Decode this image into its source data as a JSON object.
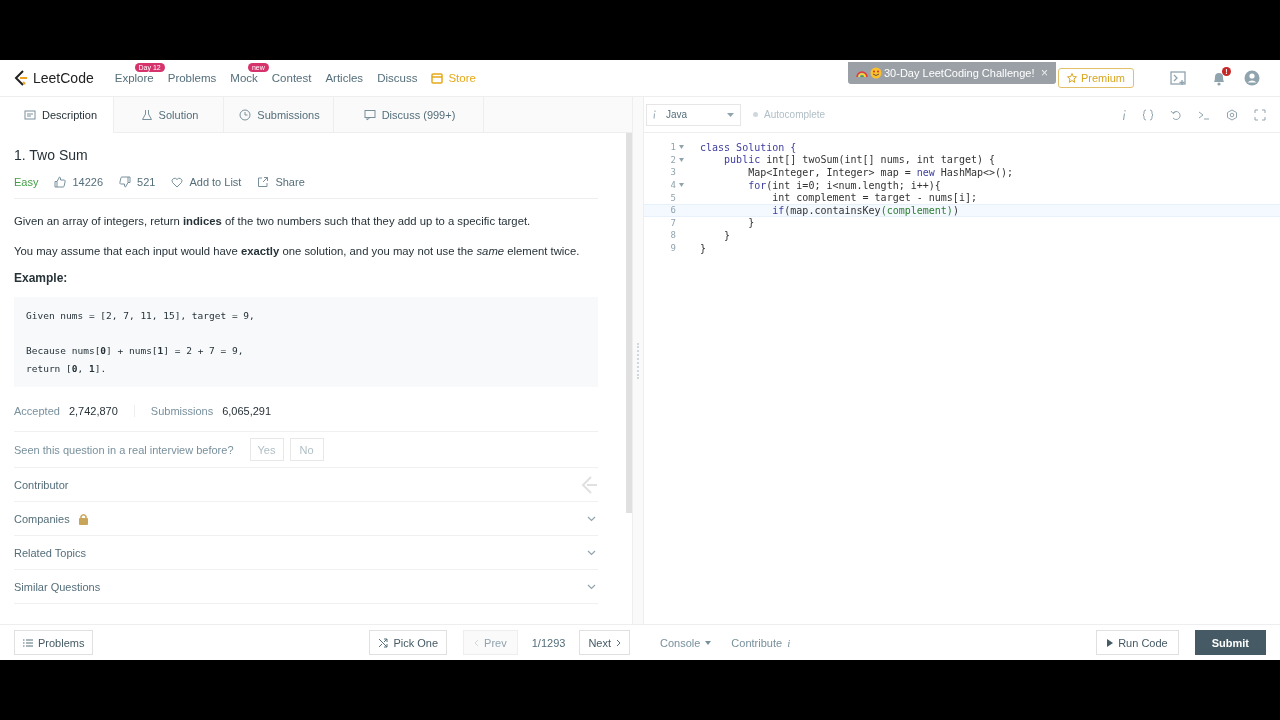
{
  "nav": {
    "logo": "LeetCode",
    "items": [
      {
        "label": "Explore",
        "badge": "Day 12",
        "kind": "link"
      },
      {
        "label": "Problems",
        "kind": "link"
      },
      {
        "label": "Mock",
        "badge": "new",
        "kind": "link"
      },
      {
        "label": "Contest",
        "kind": "link"
      },
      {
        "label": "Articles",
        "kind": "link"
      },
      {
        "label": "Discuss",
        "kind": "link"
      },
      {
        "label": "Store",
        "kind": "store"
      }
    ],
    "banner": "30-Day LeetCoding Challenge!",
    "close": "×",
    "premium": "Premium",
    "notification_badge": "!"
  },
  "tabs": [
    {
      "label": "Description",
      "selected": true
    },
    {
      "label": "Solution",
      "selected": false
    },
    {
      "label": "Submissions",
      "selected": false
    },
    {
      "label": "Discuss (999+)",
      "selected": false
    }
  ],
  "problem": {
    "title": "1. Two Sum",
    "difficulty": "Easy",
    "likes": "14226",
    "dislikes": "521",
    "add_to_list": "Add to List",
    "share": "Share",
    "paragraphs": [
      "Given an array of integers, return **indices** of the two numbers such that they add up to a specific target.",
      "You may assume that each input would have **exactly** one solution, and you may not use the *same* element twice."
    ],
    "example_heading": "Example:",
    "example_blocks": [
      [
        "Given nums = [2, 7, 11, 15], target = 9,"
      ],
      [
        "Because nums[**0**] + nums[**1**] = 2 + 7 = 9,",
        "return [**0**, **1**]."
      ]
    ],
    "stats": [
      {
        "label": "Accepted",
        "value": "2,742,870"
      },
      {
        "label": "Submissions",
        "value": "6,065,291"
      }
    ],
    "interview": {
      "question": "Seen this question in a real interview before?",
      "buttons": [
        "Yes",
        "No"
      ]
    },
    "sections": [
      {
        "label": "Contributor",
        "kind": "contributor"
      },
      {
        "label": "Companies",
        "kind": "locked"
      },
      {
        "label": "Related Topics",
        "kind": "collapsible"
      },
      {
        "label": "Similar Questions",
        "kind": "collapsible"
      }
    ]
  },
  "editor": {
    "language": "Java",
    "autocomplete": {
      "label": "Autocomplete",
      "on": false
    },
    "lines": [
      {
        "number": "1",
        "foldable": true,
        "current": false,
        "segments": [
          {
            "text": "class Solution {",
            "kind": "keyword"
          }
        ]
      },
      {
        "number": "2",
        "foldable": true,
        "current": false,
        "segments": [
          {
            "text": "    public ",
            "kind": "keyword"
          },
          {
            "text": "int[] twoSum(int[] nums, int target) {",
            "kind": "plain"
          }
        ]
      },
      {
        "number": "3",
        "foldable": false,
        "current": false,
        "segments": [
          {
            "text": "        Map<Integer, Integer> map = ",
            "kind": "plain"
          },
          {
            "text": "new",
            "kind": "keyword"
          },
          {
            "text": " HashMap<>();",
            "kind": "plain"
          }
        ]
      },
      {
        "number": "4",
        "foldable": true,
        "current": false,
        "segments": [
          {
            "text": "        for",
            "kind": "keyword"
          },
          {
            "text": "(int i=0; i<num.length; i++){",
            "kind": "plain"
          }
        ]
      },
      {
        "number": "5",
        "foldable": false,
        "current": false,
        "segments": [
          {
            "text": "            int complement = target - nums[i];",
            "kind": "plain"
          }
        ]
      },
      {
        "number": "6",
        "foldable": false,
        "current": true,
        "segments": [
          {
            "text": "            if",
            "kind": "keyword"
          },
          {
            "text": "(map.containsKey",
            "kind": "plain"
          },
          {
            "text": "(complement)",
            "kind": "bracket"
          },
          {
            "text": ")",
            "kind": "plain"
          }
        ]
      },
      {
        "number": "7",
        "foldable": false,
        "current": false,
        "segments": [
          {
            "text": "        }",
            "kind": "plain"
          }
        ]
      },
      {
        "number": "8",
        "foldable": false,
        "current": false,
        "segments": [
          {
            "text": "    }",
            "kind": "plain"
          }
        ]
      },
      {
        "number": "9",
        "foldable": false,
        "current": false,
        "segments": [
          {
            "text": "}",
            "kind": "plain"
          }
        ]
      }
    ]
  },
  "footer": {
    "problems": "Problems",
    "pick_one": "Pick One",
    "prev": {
      "label": "Prev",
      "disabled": true
    },
    "position": "1/1293",
    "next": {
      "label": "Next",
      "disabled": false
    },
    "console": "Console",
    "contribute": "Contribute",
    "contribute_info": "i",
    "run_code": "Run Code",
    "submit": "Submit"
  }
}
